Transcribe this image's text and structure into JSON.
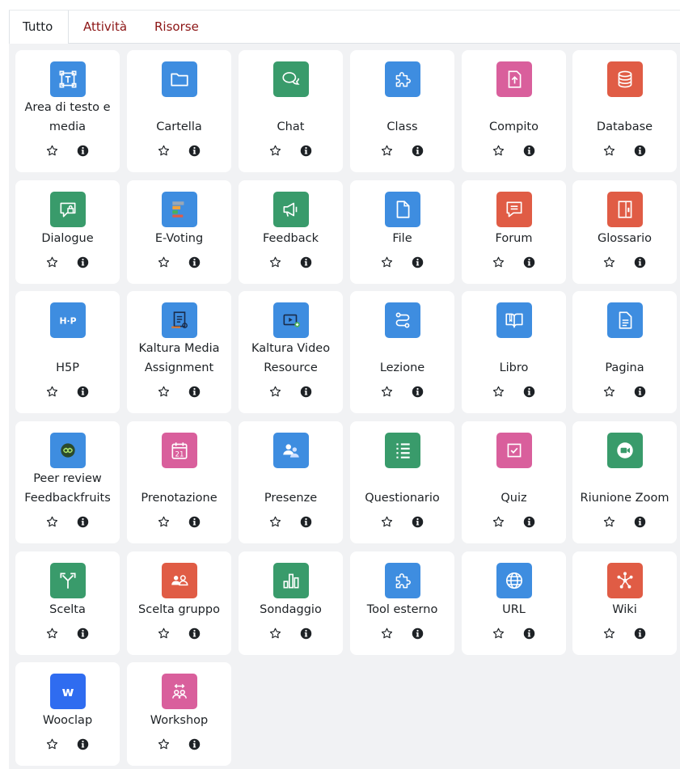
{
  "tabs": [
    {
      "label": "Tutto",
      "active": true
    },
    {
      "label": "Attività",
      "active": false
    },
    {
      "label": "Risorse",
      "active": false
    }
  ],
  "modules": [
    {
      "name": "Area di testo e media",
      "icon": "text-area-icon",
      "color": "#3e8de0"
    },
    {
      "name": "Cartella",
      "icon": "folder-icon",
      "color": "#3e8de0"
    },
    {
      "name": "Chat",
      "icon": "chat-icon",
      "color": "#399b6b"
    },
    {
      "name": "Class",
      "icon": "puzzle-icon",
      "color": "#3e8de0"
    },
    {
      "name": "Compito",
      "icon": "assignment-icon",
      "color": "#d95f9c"
    },
    {
      "name": "Database",
      "icon": "database-icon",
      "color": "#e05c45"
    },
    {
      "name": "Dialogue",
      "icon": "dialogue-icon",
      "color": "#399b6b"
    },
    {
      "name": "E-Voting",
      "icon": "evoting-icon",
      "color": "#3e8de0"
    },
    {
      "name": "Feedback",
      "icon": "megaphone-icon",
      "color": "#399b6b"
    },
    {
      "name": "File",
      "icon": "file-icon",
      "color": "#3e8de0"
    },
    {
      "name": "Forum",
      "icon": "forum-icon",
      "color": "#e05c45"
    },
    {
      "name": "Glossario",
      "icon": "glossary-icon",
      "color": "#e05c45"
    },
    {
      "name": "H5P",
      "icon": "h5p-icon",
      "color": "#3e8de0"
    },
    {
      "name": "Kaltura Media Assignment",
      "icon": "kaltura-assignment-icon",
      "color": "#3e8de0"
    },
    {
      "name": "Kaltura Video Resource",
      "icon": "kaltura-video-icon",
      "color": "#3e8de0"
    },
    {
      "name": "Lezione",
      "icon": "lesson-icon",
      "color": "#3e8de0"
    },
    {
      "name": "Libro",
      "icon": "book-icon",
      "color": "#3e8de0"
    },
    {
      "name": "Pagina",
      "icon": "page-icon",
      "color": "#3e8de0"
    },
    {
      "name": "Peer review Feedbackfruits",
      "icon": "feedbackfruits-icon",
      "color": "#3e8de0"
    },
    {
      "name": "Prenotazione",
      "icon": "calendar-icon",
      "color": "#d95f9c"
    },
    {
      "name": "Presenze",
      "icon": "attendance-icon",
      "color": "#3e8de0"
    },
    {
      "name": "Questionario",
      "icon": "questionnaire-icon",
      "color": "#399b6b"
    },
    {
      "name": "Quiz",
      "icon": "quiz-icon",
      "color": "#d95f9c"
    },
    {
      "name": "Riunione Zoom",
      "icon": "zoom-icon",
      "color": "#399b6b"
    },
    {
      "name": "Scelta",
      "icon": "choice-icon",
      "color": "#399b6b"
    },
    {
      "name": "Scelta gruppo",
      "icon": "group-choice-icon",
      "color": "#e05c45"
    },
    {
      "name": "Sondaggio",
      "icon": "survey-icon",
      "color": "#399b6b"
    },
    {
      "name": "Tool esterno",
      "icon": "puzzle-icon",
      "color": "#3e8de0"
    },
    {
      "name": "URL",
      "icon": "globe-icon",
      "color": "#3e8de0"
    },
    {
      "name": "Wiki",
      "icon": "wiki-icon",
      "color": "#e05c45"
    },
    {
      "name": "Wooclap",
      "icon": "wooclap-icon",
      "color": "#2f6cf0"
    },
    {
      "name": "Workshop",
      "icon": "workshop-icon",
      "color": "#d95f9c"
    }
  ]
}
